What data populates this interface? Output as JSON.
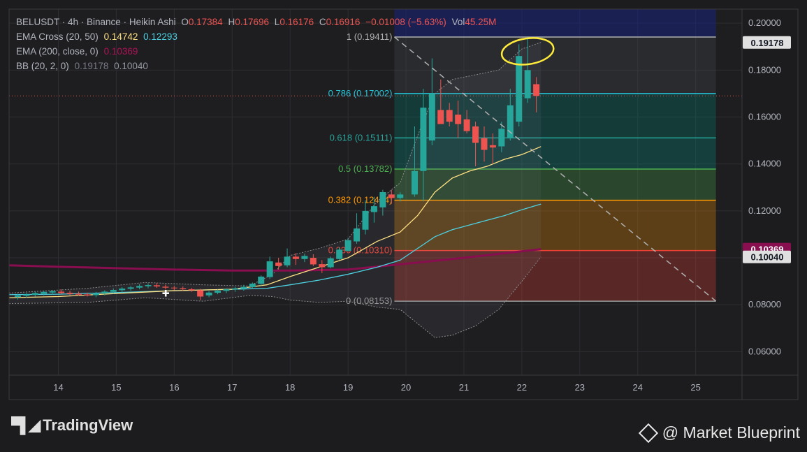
{
  "legend": {
    "symbol": "BELUSDT · 4h · Binance · Heikin Ashi",
    "ohlc": [
      {
        "label": "O",
        "value": "0.17384"
      },
      {
        "label": "H",
        "value": "0.17696"
      },
      {
        "label": "L",
        "value": "0.16176"
      },
      {
        "label": "C",
        "value": "0.16916"
      }
    ],
    "change": "−0.01008 (−5.63%)",
    "vol_label": "Vol",
    "vol_value": "45.25M",
    "ema_cross_label": "EMA Cross (20, 50)",
    "ema_cross_v1": "0.14742",
    "ema_cross_v2": "0.12293",
    "ema200_label": "EMA (200, close, 0)",
    "ema200_value": "0.10369",
    "bb_label": "BB (20, 2, 0)",
    "bb_v1": "0.19178",
    "bb_v2": "0.10040"
  },
  "colors": {
    "up": "#26a69a",
    "down": "#ef5350",
    "ema20": "#ffe082",
    "ema50": "#4dd0e1",
    "ema200": "#880e4f",
    "bb": "#8a8a8a",
    "ellipse": "#ffeb3b"
  },
  "chart_data": {
    "type": "candlestick",
    "x_ticks": [
      "14",
      "15",
      "16",
      "17",
      "18",
      "19",
      "20",
      "21",
      "22",
      "23",
      "24",
      "25"
    ],
    "y_ticks": [
      "0.20000",
      "0.18000",
      "0.16000",
      "0.14000",
      "0.12000",
      "0.10000",
      "0.08000",
      "0.06000"
    ],
    "ylim": [
      0.05,
      0.206
    ],
    "xlim": [
      13.15,
      25.8
    ],
    "price_badges": [
      {
        "value": 0.19178,
        "label": "0.19178",
        "bg": "#e0e0e0",
        "fg": "#131722"
      },
      {
        "value": 0.10369,
        "label": "0.10369",
        "bg": "#880e4f",
        "fg": "#ffffff"
      },
      {
        "value": 0.1004,
        "label": "0.10040",
        "bg": "#e0e0e0",
        "fg": "#131722"
      }
    ],
    "fib": {
      "x_start": 19.8,
      "x_end": 25.35,
      "levels": [
        {
          "ratio": "1",
          "value": 0.19411,
          "label": "1 (0.19411)",
          "color": "#b0b0b0",
          "fill": "#787b86"
        },
        {
          "ratio": "0.786",
          "value": 0.17002,
          "label": "0.786 (0.17002)",
          "color": "#26c6da",
          "fill": "#4a4e57"
        },
        {
          "ratio": "0.618",
          "value": 0.15111,
          "label": "0.618 (0.15111)",
          "color": "#26a69a",
          "fill": "#00897b"
        },
        {
          "ratio": "0.5",
          "value": 0.13782,
          "label": "0.5 (0.13782)",
          "color": "#4caf50",
          "fill": "#009688"
        },
        {
          "ratio": "0.382",
          "value": 0.12454,
          "label": "0.382 (0.12454)",
          "color": "#ff9800",
          "fill": "#4caf50"
        },
        {
          "ratio": "0.236",
          "value": 0.1031,
          "label": "0.236 (0.10310)",
          "color": "#f44336",
          "fill": "#ff9800"
        },
        {
          "ratio": "0",
          "value": 0.08153,
          "label": "0 (0.08153)",
          "color": "#9e9e9e",
          "fill": "#f44336"
        }
      ]
    },
    "candles": [
      {
        "t": 13.3,
        "o": 0.0833,
        "h": 0.0847,
        "l": 0.0822,
        "c": 0.084
      },
      {
        "t": 13.45,
        "o": 0.0838,
        "h": 0.085,
        "l": 0.083,
        "c": 0.0844
      },
      {
        "t": 13.6,
        "o": 0.0842,
        "h": 0.0855,
        "l": 0.0835,
        "c": 0.085
      },
      {
        "t": 13.75,
        "o": 0.0847,
        "h": 0.086,
        "l": 0.084,
        "c": 0.0855
      },
      {
        "t": 13.9,
        "o": 0.0852,
        "h": 0.0862,
        "l": 0.0843,
        "c": 0.0858
      },
      {
        "t": 14.05,
        "o": 0.0856,
        "h": 0.0866,
        "l": 0.0846,
        "c": 0.085
      },
      {
        "t": 14.2,
        "o": 0.0851,
        "h": 0.086,
        "l": 0.084,
        "c": 0.0846
      },
      {
        "t": 14.35,
        "o": 0.0847,
        "h": 0.0856,
        "l": 0.0838,
        "c": 0.0843
      },
      {
        "t": 14.5,
        "o": 0.0844,
        "h": 0.0852,
        "l": 0.0835,
        "c": 0.084
      },
      {
        "t": 14.65,
        "o": 0.0841,
        "h": 0.0855,
        "l": 0.0832,
        "c": 0.0849
      },
      {
        "t": 14.8,
        "o": 0.0848,
        "h": 0.0862,
        "l": 0.084,
        "c": 0.0856
      },
      {
        "t": 14.95,
        "o": 0.0855,
        "h": 0.087,
        "l": 0.0848,
        "c": 0.0863
      },
      {
        "t": 15.1,
        "o": 0.0862,
        "h": 0.0875,
        "l": 0.0853,
        "c": 0.0869
      },
      {
        "t": 15.25,
        "o": 0.0868,
        "h": 0.088,
        "l": 0.086,
        "c": 0.0874
      },
      {
        "t": 15.4,
        "o": 0.0873,
        "h": 0.0888,
        "l": 0.0866,
        "c": 0.088
      },
      {
        "t": 15.55,
        "o": 0.0879,
        "h": 0.0892,
        "l": 0.087,
        "c": 0.0884
      },
      {
        "t": 15.7,
        "o": 0.0883,
        "h": 0.0893,
        "l": 0.0872,
        "c": 0.0878
      },
      {
        "t": 15.85,
        "o": 0.0877,
        "h": 0.0886,
        "l": 0.0865,
        "c": 0.0873
      },
      {
        "t": 16.0,
        "o": 0.0873,
        "h": 0.088,
        "l": 0.0862,
        "c": 0.087
      },
      {
        "t": 16.15,
        "o": 0.087,
        "h": 0.0878,
        "l": 0.086,
        "c": 0.0866
      },
      {
        "t": 16.3,
        "o": 0.0866,
        "h": 0.0872,
        "l": 0.0855,
        "c": 0.0862
      },
      {
        "t": 16.45,
        "o": 0.0862,
        "h": 0.0868,
        "l": 0.082,
        "c": 0.0835
      },
      {
        "t": 16.6,
        "o": 0.084,
        "h": 0.0858,
        "l": 0.0832,
        "c": 0.0852
      },
      {
        "t": 16.75,
        "o": 0.0851,
        "h": 0.0865,
        "l": 0.0845,
        "c": 0.086
      },
      {
        "t": 16.9,
        "o": 0.0859,
        "h": 0.087,
        "l": 0.085,
        "c": 0.0866
      },
      {
        "t": 17.05,
        "o": 0.0865,
        "h": 0.0876,
        "l": 0.0855,
        "c": 0.087
      },
      {
        "t": 17.2,
        "o": 0.0869,
        "h": 0.0885,
        "l": 0.086,
        "c": 0.0876
      },
      {
        "t": 17.35,
        "o": 0.0875,
        "h": 0.0895,
        "l": 0.0868,
        "c": 0.089
      },
      {
        "t": 17.5,
        "o": 0.0889,
        "h": 0.0925,
        "l": 0.088,
        "c": 0.092
      },
      {
        "t": 17.65,
        "o": 0.0918,
        "h": 0.1005,
        "l": 0.091,
        "c": 0.0985
      },
      {
        "t": 17.8,
        "o": 0.098,
        "h": 0.1,
        "l": 0.095,
        "c": 0.0965
      },
      {
        "t": 17.95,
        "o": 0.0968,
        "h": 0.104,
        "l": 0.096,
        "c": 0.1005
      },
      {
        "t": 18.1,
        "o": 0.1005,
        "h": 0.102,
        "l": 0.097,
        "c": 0.0995
      },
      {
        "t": 18.25,
        "o": 0.0995,
        "h": 0.1018,
        "l": 0.0982,
        "c": 0.1008
      },
      {
        "t": 18.4,
        "o": 0.1,
        "h": 0.1015,
        "l": 0.0965,
        "c": 0.0972
      },
      {
        "t": 18.55,
        "o": 0.0973,
        "h": 0.099,
        "l": 0.0935,
        "c": 0.096
      },
      {
        "t": 18.7,
        "o": 0.096,
        "h": 0.1005,
        "l": 0.0955,
        "c": 0.0998
      },
      {
        "t": 18.85,
        "o": 0.0995,
        "h": 0.1045,
        "l": 0.099,
        "c": 0.1035
      },
      {
        "t": 19.0,
        "o": 0.103,
        "h": 0.1085,
        "l": 0.1025,
        "c": 0.1075
      },
      {
        "t": 19.15,
        "o": 0.107,
        "h": 0.119,
        "l": 0.106,
        "c": 0.1125
      },
      {
        "t": 19.3,
        "o": 0.112,
        "h": 0.1245,
        "l": 0.11,
        "c": 0.12
      },
      {
        "t": 19.45,
        "o": 0.1195,
        "h": 0.126,
        "l": 0.115,
        "c": 0.122
      },
      {
        "t": 19.6,
        "o": 0.1215,
        "h": 0.129,
        "l": 0.118,
        "c": 0.128
      },
      {
        "t": 19.75,
        "o": 0.127,
        "h": 0.129,
        "l": 0.123,
        "c": 0.1255
      },
      {
        "t": 19.9,
        "o": 0.1255,
        "h": 0.128,
        "l": 0.124,
        "c": 0.127
      },
      {
        "t": 20.15,
        "o": 0.127,
        "h": 0.156,
        "l": 0.126,
        "c": 0.137
      },
      {
        "t": 20.3,
        "o": 0.137,
        "h": 0.172,
        "l": 0.124,
        "c": 0.164
      },
      {
        "t": 20.45,
        "o": 0.15,
        "h": 0.185,
        "l": 0.148,
        "c": 0.17
      },
      {
        "t": 20.6,
        "o": 0.163,
        "h": 0.176,
        "l": 0.158,
        "c": 0.157
      },
      {
        "t": 20.75,
        "o": 0.163,
        "h": 0.166,
        "l": 0.156,
        "c": 0.158
      },
      {
        "t": 20.9,
        "o": 0.161,
        "h": 0.167,
        "l": 0.151,
        "c": 0.157
      },
      {
        "t": 21.05,
        "o": 0.159,
        "h": 0.163,
        "l": 0.153,
        "c": 0.154
      },
      {
        "t": 21.2,
        "o": 0.156,
        "h": 0.158,
        "l": 0.139,
        "c": 0.149
      },
      {
        "t": 21.35,
        "o": 0.151,
        "h": 0.156,
        "l": 0.141,
        "c": 0.146
      },
      {
        "t": 21.5,
        "o": 0.148,
        "h": 0.153,
        "l": 0.14,
        "c": 0.147
      },
      {
        "t": 21.65,
        "o": 0.1475,
        "h": 0.158,
        "l": 0.145,
        "c": 0.155
      },
      {
        "t": 21.8,
        "o": 0.151,
        "h": 0.172,
        "l": 0.15,
        "c": 0.165
      },
      {
        "t": 21.95,
        "o": 0.158,
        "h": 0.191,
        "l": 0.156,
        "c": 0.186
      },
      {
        "t": 22.1,
        "o": 0.168,
        "h": 0.194,
        "l": 0.166,
        "c": 0.18
      },
      {
        "t": 22.25,
        "o": 0.174,
        "h": 0.177,
        "l": 0.162,
        "c": 0.169
      }
    ],
    "ema20": [
      [
        13.15,
        0.083
      ],
      [
        14.0,
        0.0835
      ],
      [
        15.0,
        0.0848
      ],
      [
        16.0,
        0.086
      ],
      [
        17.0,
        0.0866
      ],
      [
        17.6,
        0.0885
      ],
      [
        18.0,
        0.092
      ],
      [
        18.5,
        0.096
      ],
      [
        19.0,
        0.1
      ],
      [
        19.5,
        0.107
      ],
      [
        19.9,
        0.111
      ],
      [
        20.2,
        0.118
      ],
      [
        20.5,
        0.128
      ],
      [
        20.8,
        0.134
      ],
      [
        21.1,
        0.137
      ],
      [
        21.4,
        0.139
      ],
      [
        21.7,
        0.142
      ],
      [
        22.0,
        0.144
      ],
      [
        22.33,
        0.1474
      ]
    ],
    "ema50": [
      [
        13.15,
        0.0843
      ],
      [
        14.0,
        0.0845
      ],
      [
        15.0,
        0.0852
      ],
      [
        16.0,
        0.086
      ],
      [
        17.0,
        0.0866
      ],
      [
        17.6,
        0.087
      ],
      [
        18.0,
        0.0885
      ],
      [
        18.5,
        0.0905
      ],
      [
        19.0,
        0.093
      ],
      [
        19.5,
        0.096
      ],
      [
        19.9,
        0.099
      ],
      [
        20.2,
        0.104
      ],
      [
        20.5,
        0.109
      ],
      [
        20.8,
        0.112
      ],
      [
        21.1,
        0.114
      ],
      [
        21.4,
        0.116
      ],
      [
        21.7,
        0.118
      ],
      [
        22.0,
        0.1205
      ],
      [
        22.33,
        0.1229
      ]
    ],
    "ema200": [
      [
        13.15,
        0.0968
      ],
      [
        14.0,
        0.0962
      ],
      [
        15.0,
        0.0956
      ],
      [
        16.0,
        0.095
      ],
      [
        17.0,
        0.0946
      ],
      [
        18.0,
        0.0946
      ],
      [
        19.0,
        0.095
      ],
      [
        20.0,
        0.0975
      ],
      [
        21.0,
        0.1
      ],
      [
        22.33,
        0.1037
      ]
    ],
    "bb_upper": [
      [
        13.15,
        0.085
      ],
      [
        14.5,
        0.087
      ],
      [
        15.5,
        0.0895
      ],
      [
        16.5,
        0.0885
      ],
      [
        17.3,
        0.088
      ],
      [
        17.7,
        0.093
      ],
      [
        18.0,
        0.101
      ],
      [
        18.5,
        0.104
      ],
      [
        19.0,
        0.108
      ],
      [
        19.5,
        0.124
      ],
      [
        19.9,
        0.132
      ],
      [
        20.2,
        0.152
      ],
      [
        20.5,
        0.17
      ],
      [
        20.8,
        0.176
      ],
      [
        21.2,
        0.178
      ],
      [
        21.6,
        0.18
      ],
      [
        22.0,
        0.189
      ],
      [
        22.33,
        0.1918
      ]
    ],
    "bb_lower": [
      [
        13.15,
        0.0805
      ],
      [
        14.5,
        0.081
      ],
      [
        15.5,
        0.083
      ],
      [
        16.5,
        0.0815
      ],
      [
        17.3,
        0.084
      ],
      [
        17.7,
        0.0835
      ],
      [
        18.0,
        0.082
      ],
      [
        18.5,
        0.081
      ],
      [
        19.0,
        0.0815
      ],
      [
        19.5,
        0.079
      ],
      [
        19.9,
        0.078
      ],
      [
        20.2,
        0.072
      ],
      [
        20.5,
        0.066
      ],
      [
        20.8,
        0.067
      ],
      [
        21.2,
        0.071
      ],
      [
        21.6,
        0.078
      ],
      [
        22.0,
        0.09
      ],
      [
        22.33,
        0.1004
      ]
    ],
    "trend_line": {
      "x1": 19.8,
      "y1": 0.19411,
      "x2": 25.35,
      "y2": 0.08153
    },
    "ellipse": {
      "cx": 22.1,
      "cy": 0.188,
      "rx": 0.45,
      "ry": 0.0055
    }
  },
  "footer": {
    "logo_text": "TradingView",
    "watermark": "@ Market Blueprint"
  }
}
